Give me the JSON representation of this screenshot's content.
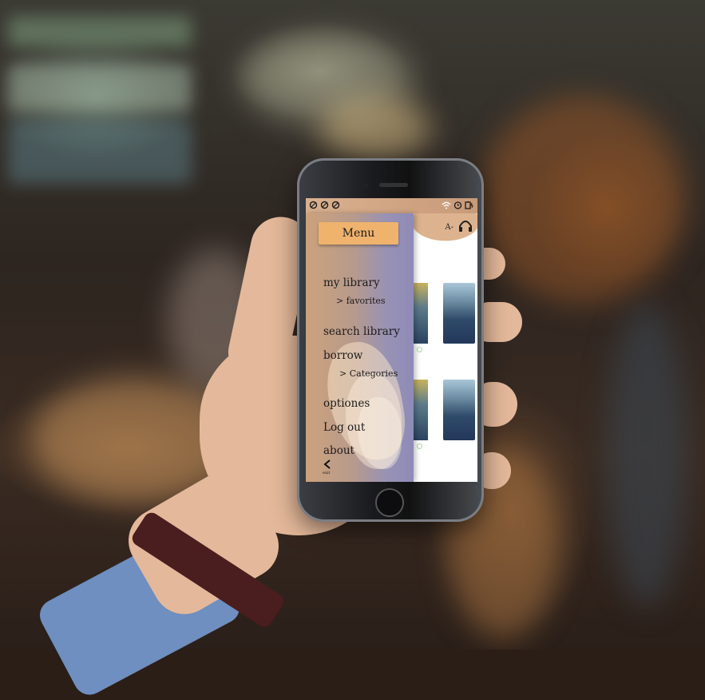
{
  "status_bar": {
    "left_icons": [
      "notification-icon",
      "notification-icon",
      "notification-icon"
    ],
    "right_icons": [
      "wifi-icon",
      "alarm-icon",
      "battery-icon"
    ]
  },
  "top_icons": {
    "text_size_label": "A-",
    "audio_icon": "headphones-icon"
  },
  "menu": {
    "title": "Menu",
    "items": [
      {
        "label": "my library"
      },
      {
        "label": "> favorites"
      },
      {
        "label": "search library"
      },
      {
        "label": "borrow"
      },
      {
        "label": "> Categories"
      },
      {
        "label": "optiones"
      },
      {
        "label": "Log out"
      },
      {
        "label": "about"
      }
    ],
    "back_icon": "chevron-left-icon",
    "back_label": "exit"
  },
  "colors": {
    "status_bar": "#d9b190",
    "menu_header": "#efb36e",
    "menu_gradient_start": "#cda27b",
    "menu_gradient_end": "#8e8bb8"
  }
}
